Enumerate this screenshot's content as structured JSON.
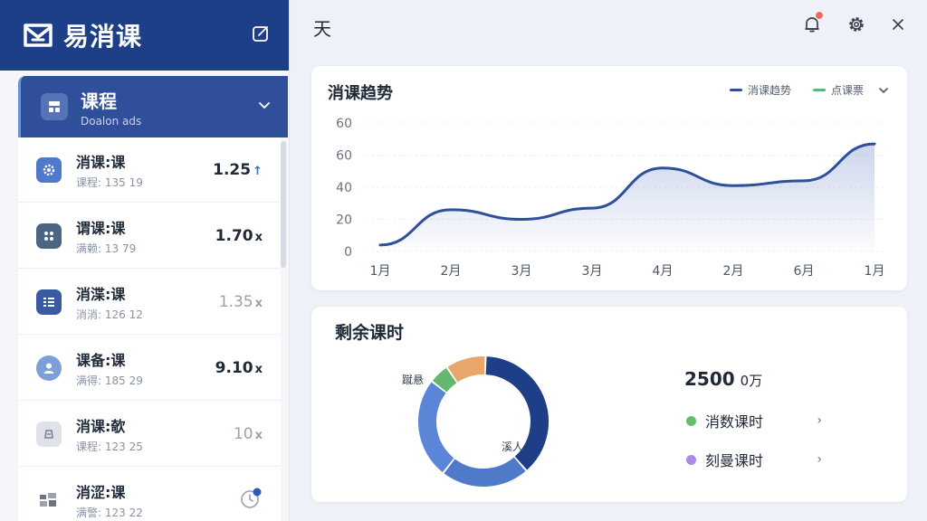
{
  "app": {
    "name": "易消课"
  },
  "course_header": {
    "title": "课程",
    "subtitle": "Doalon ads"
  },
  "course_items": [
    {
      "title": "消课:课",
      "sub": "课程:‍ 135 19",
      "value": "1.25",
      "suffix": "↑",
      "icon": "gear-icon",
      "icon_bg": "#4f79c9",
      "muted": false
    },
    {
      "title": "谓课:课",
      "sub": "满赖:‍ 13 79",
      "value": "1.70",
      "suffix": "x",
      "icon": "group-icon",
      "icon_bg": "#4b6583",
      "muted": false
    },
    {
      "title": "消渫:课",
      "sub": "消消:‍ 126 12",
      "value": "1.35",
      "suffix": "x",
      "icon": "list-icon",
      "icon_bg": "#3a5aa2",
      "muted": true
    },
    {
      "title": "课备:课",
      "sub": "满得:‍ 185 29",
      "value": "9.10",
      "suffix": "x",
      "icon": "user-icon",
      "icon_bg": "#7d9fd9",
      "muted": false
    },
    {
      "title": "消课:欹",
      "sub": "课程:‍ 123 25",
      "value": "10",
      "suffix": "x",
      "icon": "card-icon",
      "icon_bg": "#dfe2e8",
      "muted": true
    },
    {
      "title": "消涩:课",
      "sub": "满警:‍ 123 22",
      "value": "",
      "suffix": "",
      "icon": "grid-icon",
      "icon_bg": "#ffffff",
      "muted": false
    }
  ],
  "topbar": {
    "title": "天"
  },
  "trend": {
    "title": "消课趋势",
    "legend": [
      {
        "label": "消课趋势",
        "color": "#2d4f9c"
      },
      {
        "label": "点课票",
        "color": "#5cb87a"
      }
    ]
  },
  "chart_data": {
    "type": "area",
    "title": "消课趋势",
    "categories": [
      "1月",
      "2月",
      "3月",
      "3月",
      "4月",
      "2月",
      "6月",
      "1月"
    ],
    "series": [
      {
        "name": "消课趋势",
        "values": [
          4,
          26,
          20,
          27,
          52,
          41,
          44,
          67
        ],
        "color": "#2d4f9c"
      }
    ],
    "yticks": [
      "0",
      "20",
      "40",
      "60",
      "60"
    ],
    "ylim": [
      0,
      80
    ],
    "grid": true,
    "legend_position": "top-right"
  },
  "remaining": {
    "title": "剩余课时",
    "total": "2500",
    "unit": "0万",
    "stats": [
      {
        "label": "消数课时",
        "color": "#66bd72",
        "arrow": "›"
      },
      {
        "label": "刻曼课时",
        "color": "#a98be6",
        "arrow": "›"
      }
    ],
    "donut_labels": {
      "top_left": "蹴悬",
      "inside": "溪人"
    },
    "donut": [
      {
        "value": 38,
        "color": "#1e3f87"
      },
      {
        "value": 22,
        "color": "#4f79c9"
      },
      {
        "value": 25,
        "color": "#5b86d8"
      },
      {
        "value": 5,
        "color": "#63b76e"
      },
      {
        "value": 10,
        "color": "#e9a66b"
      }
    ]
  }
}
